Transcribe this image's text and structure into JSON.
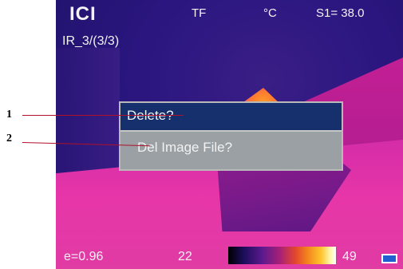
{
  "header": {
    "brand": "ICI",
    "mode": "TF",
    "unit": "°C",
    "setpoint": "S1= 38.0",
    "file_index": "IR_3/(3/3)"
  },
  "dialog": {
    "title": "Delete?",
    "message": "Del Image File?"
  },
  "footer": {
    "emissivity": "e=0.96",
    "scale_min": "22",
    "scale_max": "49"
  },
  "callouts": [
    {
      "label": "1"
    },
    {
      "label": "2"
    }
  ],
  "colors": {
    "dialog_title_bg": "#15306d",
    "dialog_body_bg": "#9aa0a4",
    "callout_line": "#b0102a",
    "battery": "#1f5fd0"
  },
  "icons": [
    "battery-icon"
  ]
}
